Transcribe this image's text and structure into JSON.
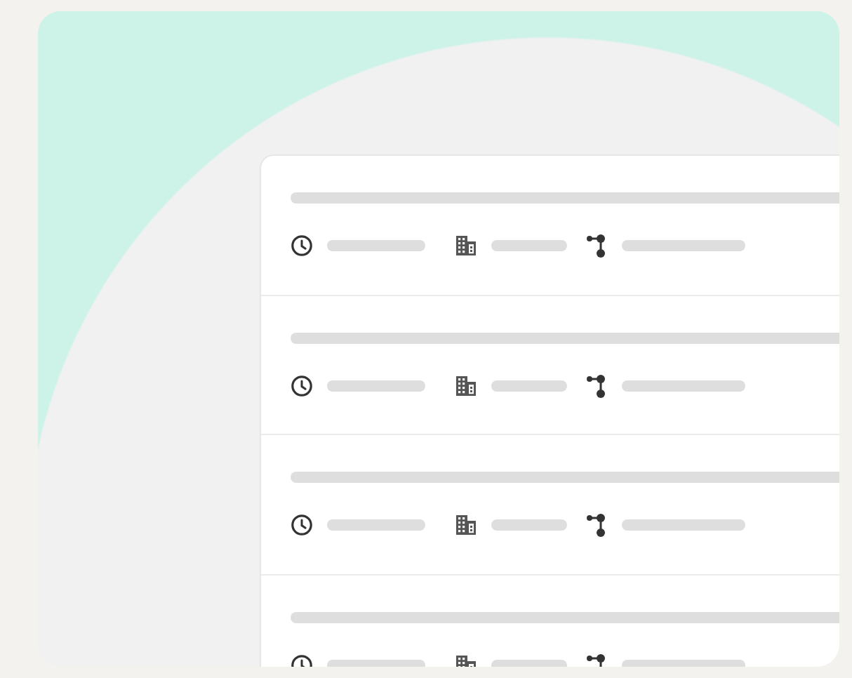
{
  "list": {
    "rows": [
      {
        "kind": "skeleton"
      },
      {
        "kind": "skeleton"
      },
      {
        "kind": "skeleton"
      },
      {
        "kind": "skeleton"
      }
    ]
  }
}
